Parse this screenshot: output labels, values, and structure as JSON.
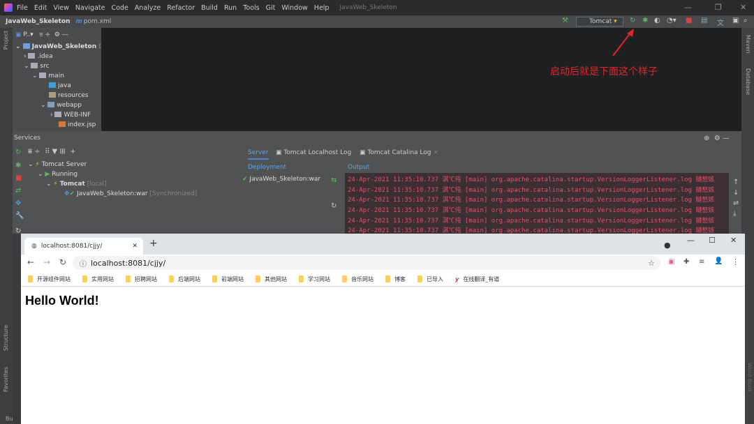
{
  "ide": {
    "menu": [
      "File",
      "Edit",
      "View",
      "Navigate",
      "Code",
      "Analyze",
      "Refactor",
      "Build",
      "Run",
      "Tools",
      "Git",
      "Window",
      "Help"
    ],
    "window_title": "JavaWeb_Skeleton",
    "breadcrumb": {
      "project": "JavaWeb_Skeleton",
      "file": "pom.xml"
    },
    "run_config": "Tomcat",
    "project_panel": {
      "label": "P..",
      "tree": [
        {
          "label": "JavaWeb_Skeleton",
          "suffix": "D:\\"
        },
        {
          "label": ".idea"
        },
        {
          "label": "src"
        },
        {
          "label": "main"
        },
        {
          "label": "java"
        },
        {
          "label": "resources"
        },
        {
          "label": "webapp"
        },
        {
          "label": "WEB-INF"
        },
        {
          "label": "index.jsp"
        }
      ]
    },
    "side_tabs": {
      "left_top": "Project",
      "left_structure": "Structure",
      "left_favorites": "Favorites",
      "right_maven": "Maven",
      "right_database": "Database",
      "right_wordbook": "Word Book",
      "bottom": "Bu"
    },
    "annotation": "启动后就是下面这个样子",
    "annotation_color": "#e0282a",
    "services": {
      "title": "Services",
      "tree": [
        {
          "label": "Tomcat Server"
        },
        {
          "label": "Running"
        },
        {
          "label": "Tomcat",
          "suffix": "[local]"
        },
        {
          "label": "JavaWeb_Skeleton:war",
          "suffix": "[Synchronized]"
        }
      ],
      "tabs": [
        "Server",
        "Tomcat Localhost Log",
        "Tomcat Catalina Log"
      ],
      "deployment_header": "Deployment",
      "deployment_item": "JavaWeb_Skeleton:war",
      "output_header": "Output",
      "log_lines": [
        "24-Apr-2021 11:35:10.737 淇℃伅 [main] org.apache.catalina.startup.VersionLoggerListener.log 鏈嶅姟",
        "24-Apr-2021 11:35:10.737 淇℃伅 [main] org.apache.catalina.startup.VersionLoggerListener.log 鏈嶅姟",
        "24-Apr-2021 11:35:10.737 淇℃伅 [main] org.apache.catalina.startup.VersionLoggerListener.log 鏈嶅姟",
        "24-Apr-2021 11:35:10.737 淇℃伅 [main] org.apache.catalina.startup.VersionLoggerListener.log 鏈嶅姟",
        "24-Apr-2021 11:35:10.737 淇℃伅 [main] org.apache.catalina.startup.VersionLoggerListener.log 鏈嶅姟",
        "24-Apr-2021 11:35:10.737 淇℃伅 [main] org.apache.catalina.startup.VersionLoggerListener.log 鏈嶅姟"
      ]
    }
  },
  "browser": {
    "tab_title": "localhost:8081/cjjy/",
    "url": "localhost:8081/cjjy/",
    "bookmarks": [
      "开源组件网站",
      "实用网站",
      "招聘网站",
      "后端网站",
      "前端网站",
      "其他网站",
      "学习网站",
      "音乐网站",
      "博客",
      "已导入",
      "在线翻译_有道"
    ],
    "page_heading": "Hello World!"
  }
}
